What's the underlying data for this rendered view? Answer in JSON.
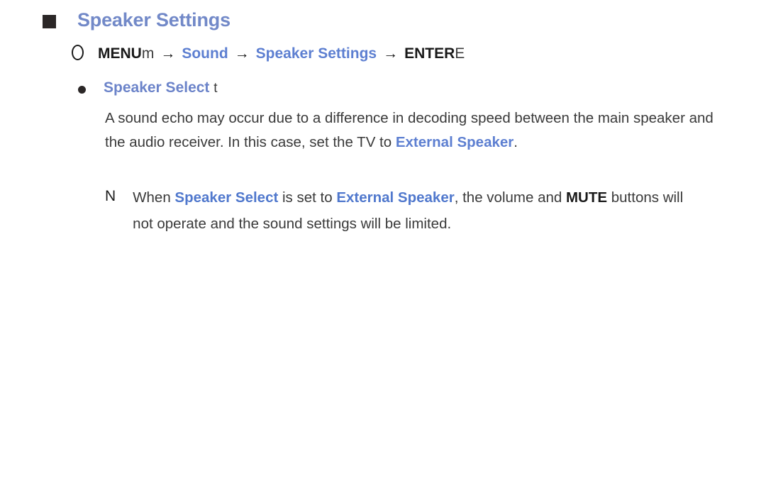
{
  "section": {
    "bullet_icon": "filled-square-bullet",
    "title": "Speaker Settings"
  },
  "menu_path": {
    "circle_icon": "outlined-circle-glyph",
    "menu_label": "MENU",
    "menu_key": "m",
    "arrow": "→",
    "step1": "Sound",
    "step2": "Speaker Settings",
    "enter_label": "ENTER",
    "enter_key": "E"
  },
  "item": {
    "bullet_icon": "filled-dot-bullet",
    "title": "Speaker Select",
    "key_glyph": "t",
    "body_line1": "A sound echo may occur due to a difference in decoding speed between",
    "body_line2a": "the main speaker and the audio receiver. In this case, set the TV to ",
    "body_highlight1": "External",
    "body_highlight2": "Speaker",
    "body_period": "."
  },
  "note": {
    "marker": "N",
    "text_a": "When ",
    "kw1": "Speaker Select",
    "text_b": " is set to ",
    "kw2": "External Speaker",
    "text_c": ", the volume and",
    "kw3": "MUTE",
    "text_d": " buttons will not operate and the sound settings will be limited."
  },
  "colors": {
    "accent_blue": "#5d7fd1",
    "heading_blue": "#7289c8",
    "bullet_dark": "#2b2727",
    "body_text": "#3a3a3a",
    "background": "#ffffff"
  }
}
